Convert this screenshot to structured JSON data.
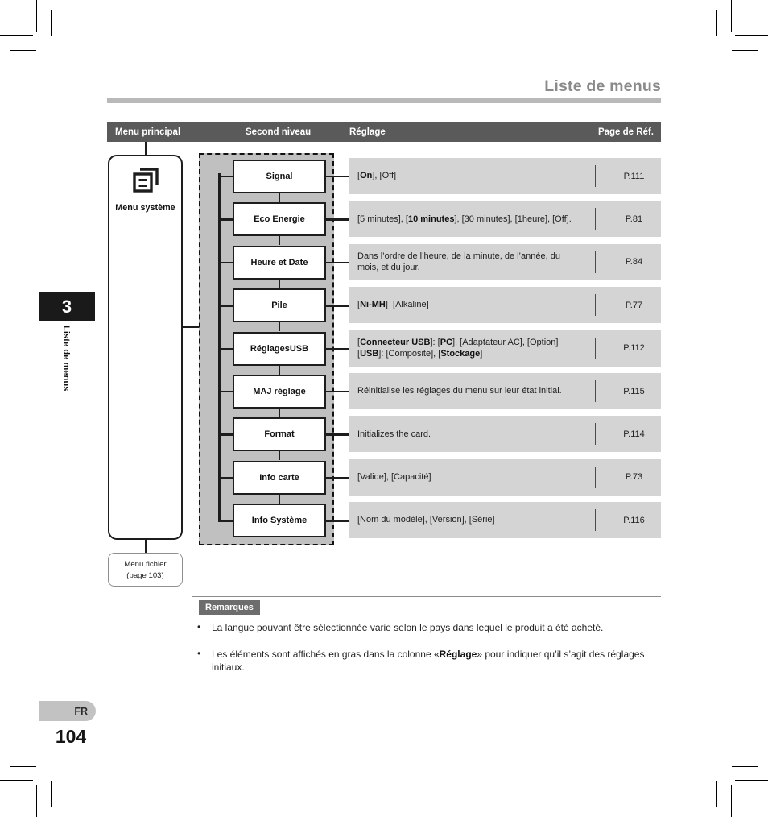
{
  "header": {
    "title": "Liste de menus"
  },
  "table_header": {
    "main_menu": "Menu principal",
    "second_level": "Second niveau",
    "setting": "Réglage",
    "page_ref": "Page de Réf."
  },
  "chapter_tab": {
    "number": "3",
    "label": "Liste de menus"
  },
  "main_menu": {
    "icon": "document-pages-icon",
    "label": "Menu système",
    "next_box": "Menu fichier\n(page 103)",
    "next_box_line1": "Menu fichier",
    "next_box_line2": "(page 103)"
  },
  "rows": [
    {
      "item": "Signal",
      "setting_html": "[<b>On</b>], [Off]",
      "page": "P.111"
    },
    {
      "item": "Eco Energie",
      "setting_html": "[5 minutes], [<b>10 minutes</b>], [30 minutes], [1heure], [Off].",
      "page": "P.81"
    },
    {
      "item": "Heure et Date",
      "setting_html": "Dans l’ordre de l’heure, de la minute, de l’année, du mois, et du jour.",
      "page": "P.84"
    },
    {
      "item": "Pile",
      "setting_html": "[<b>Ni-MH</b>]&nbsp; [Alkaline]",
      "page": "P.77"
    },
    {
      "item": "RéglagesUSB",
      "setting_html": "[<b>Connecteur USB</b>]: [<b>PC</b>], [Adaptateur AC], [Option]<br>[<b>USB</b>]: [Composite], [<b>Stockage</b>]",
      "page": "P.112"
    },
    {
      "item": "MAJ réglage",
      "setting_html": "Réinitialise les réglages du menu sur leur état initial.",
      "page": "P.115"
    },
    {
      "item": "Format",
      "setting_html": "Initializes the card.",
      "page": "P.114"
    },
    {
      "item": "Info carte",
      "setting_html": "[Valide], [Capacité]",
      "page": "P.73"
    },
    {
      "item": "Info Système",
      "setting_html": "[Nom du modèle], [Version], [Série]",
      "page": "P.116"
    }
  ],
  "remarks": {
    "badge": "Remarques",
    "bullet_char": "•",
    "items_html": [
      "La langue pouvant être sélectionnée varie selon le pays dans lequel le produit a été acheté.",
      "Les éléments sont affichés en gras dans la colonne «<b>Réglage</b>» pour indiquer qu’il s’agit des réglages initiaux."
    ]
  },
  "footer": {
    "language": "FR",
    "page_number": "104"
  },
  "colors": {
    "header_bar": "#5a5a5a",
    "panel_gray": "#c0c0c0",
    "row_gray": "#d4d4d4",
    "title_gray": "#8a8a8a",
    "tab_black": "#1a1a1a"
  }
}
